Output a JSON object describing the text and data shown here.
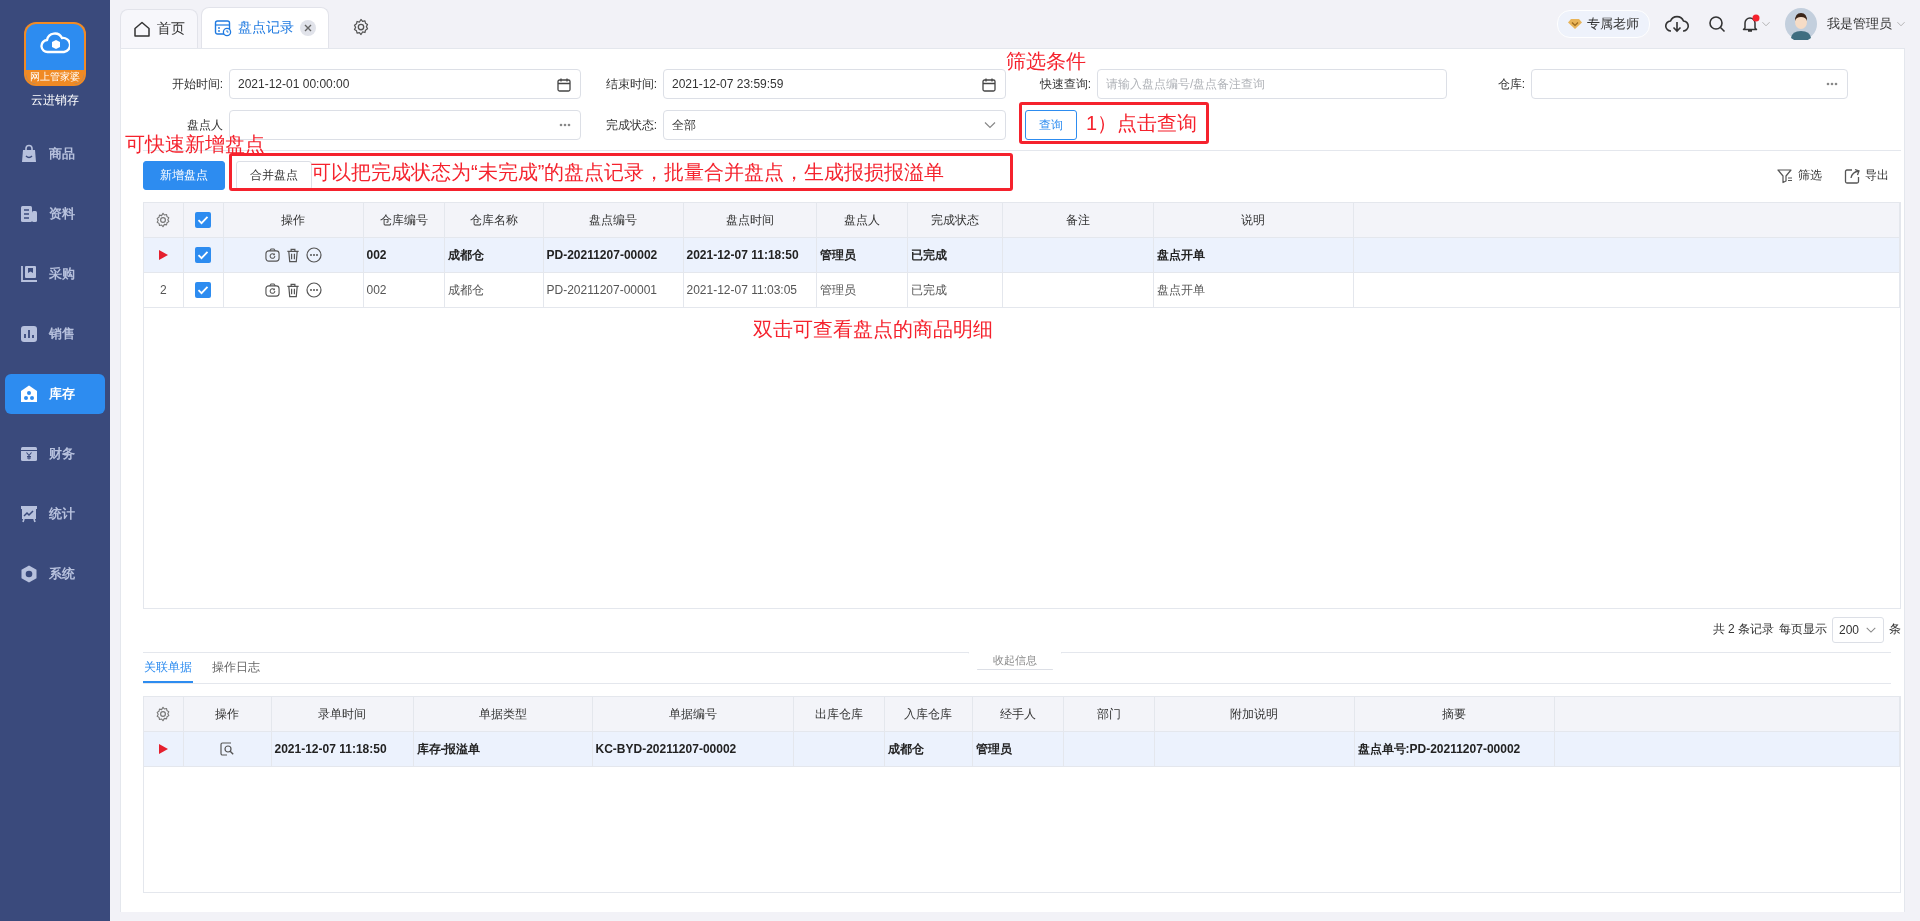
{
  "sidebar": {
    "logo_badge": "网上管家婆",
    "app_name": "云进销存",
    "items": [
      {
        "label": "商品",
        "selected": false
      },
      {
        "label": "资料",
        "selected": false
      },
      {
        "label": "采购",
        "selected": false
      },
      {
        "label": "销售",
        "selected": false
      },
      {
        "label": "库存",
        "selected": true
      },
      {
        "label": "财务",
        "selected": false
      },
      {
        "label": "统计",
        "selected": false
      },
      {
        "label": "系统",
        "selected": false
      }
    ]
  },
  "tabs": [
    {
      "label": "首页",
      "selected": false,
      "closable": false
    },
    {
      "label": "盘点记录",
      "selected": true,
      "closable": true
    }
  ],
  "header": {
    "teacher_badge": "专属老师",
    "notifications_unread": true,
    "user_name": "我是管理员"
  },
  "filters": {
    "fields": [
      {
        "label": "开始时间:",
        "kind": "date",
        "value": "2021-12-01 00:00:00"
      },
      {
        "label": "结束时间:",
        "kind": "date",
        "value": "2021-12-07 23:59:59"
      },
      {
        "label": "快速查询:",
        "kind": "text",
        "placeholder": "请输入盘点编号/盘点备注查询"
      },
      {
        "label": "仓库:",
        "kind": "lookup"
      },
      {
        "label": "盘点人",
        "kind": "lookup"
      },
      {
        "label": "完成状态:",
        "kind": "select",
        "value": "全部"
      }
    ],
    "query_button": "查询"
  },
  "toolbar": {
    "buttons": [
      {
        "label": "新增盘点",
        "kind": "primary"
      },
      {
        "label": "合并盘点",
        "kind": "default"
      }
    ],
    "actions": [
      "筛选",
      "导出"
    ]
  },
  "records": {
    "header_checked": true,
    "columns": [
      "操作",
      "仓库编号",
      "仓库名称",
      "盘点编号",
      "盘点时间",
      "盘点人",
      "完成状态",
      "备注",
      "说明"
    ],
    "rows": [
      {
        "current": true,
        "checked": true,
        "cells": [
          "",
          "002",
          "成都仓",
          "PD-20211207-00002",
          "2021-12-07 11:18:50",
          "管理员",
          "已完成",
          null,
          "盘点开单"
        ]
      },
      {
        "current": false,
        "number": "2",
        "checked": true,
        "cells": [
          "",
          "002",
          "成都仓",
          "PD-20211207-00001",
          "2021-12-07 11:03:05",
          "管理员",
          "已完成",
          null,
          "盘点开单"
        ]
      }
    ]
  },
  "pagination": {
    "total": "共 2 条记录",
    "per_page_label": "每页显示",
    "per_page": "200",
    "unit": "条"
  },
  "detail": {
    "tabs": [
      {
        "label": "关联单据",
        "selected": true
      },
      {
        "label": "操作日志",
        "selected": false
      }
    ],
    "collapse": "收起信息",
    "columns": [
      "操作",
      "录单时间",
      "单据类型",
      "单据编号",
      "出库仓库",
      "入库仓库",
      "经手人",
      "部门",
      "附加说明",
      "摘要"
    ],
    "rows": [
      {
        "current": true,
        "cells": [
          "",
          "2021-12-07 11:18:50",
          "库存-报溢单",
          "KC-BYD-20211207-00002",
          null,
          "成都仓",
          "管理员",
          null,
          null,
          "盘点单号:PD-20211207-00002"
        ]
      }
    ]
  },
  "annotations": [
    {
      "text": "筛选条件",
      "kind": "note"
    },
    {
      "text": "1）点击查询",
      "kind": "boxed"
    },
    {
      "text": "可快速新增盘点",
      "kind": "note"
    },
    {
      "text": "可以把完成状态为“未完成”的盘点记录，批量合并盘点，生成报损报溢单",
      "kind": "boxed"
    },
    {
      "text": "双击可查看盘点的商品明细",
      "kind": "note"
    }
  ]
}
